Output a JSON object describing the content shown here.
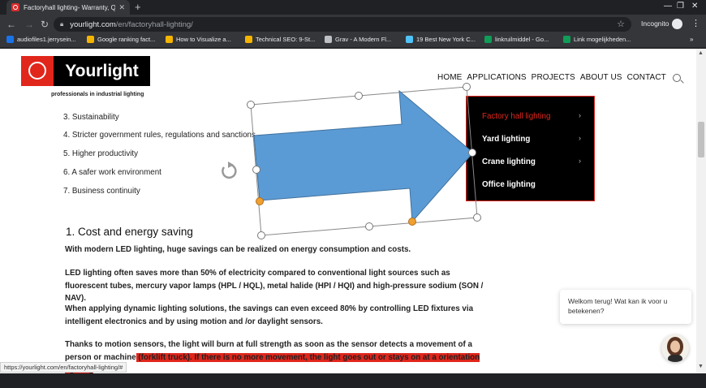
{
  "browser": {
    "tab_title": "Factoryhall lighting- Warranty, Q",
    "url_host": "yourlight.com",
    "url_path": "/en/factoryhall-lighting/",
    "incognito_label": "Incognito",
    "status_url": "https://yourlight.com/en/factoryhall-lighting/#"
  },
  "bookmarks": [
    {
      "label": "audiofiles1.jerrysein...",
      "icon": "audio-icon",
      "color": "#1a73e8"
    },
    {
      "label": "Google ranking fact...",
      "icon": "grid-icon",
      "color": "#f4b400"
    },
    {
      "label": "How to Visualize a...",
      "icon": "grid-icon",
      "color": "#f4b400"
    },
    {
      "label": "Technical SEO: 9-St...",
      "icon": "grid-icon",
      "color": "#f4b400"
    },
    {
      "label": "Grav - A Modern Fl...",
      "icon": "grav-icon",
      "color": "#bdc1c6"
    },
    {
      "label": "19 Best New York C...",
      "icon": "link-icon",
      "color": "#4fc3f7"
    },
    {
      "label": "linkruilmiddel - Go...",
      "icon": "sheet-icon",
      "color": "#0f9d58"
    },
    {
      "label": "Link mogelijkheden...",
      "icon": "sheet-icon",
      "color": "#0f9d58"
    }
  ],
  "site": {
    "logo_text": "Yourlight",
    "tagline": "professionals in industrial lighting",
    "nav": [
      "HOME",
      "APPLICATIONS",
      "PROJECTS",
      "ABOUT US",
      "CONTACT"
    ]
  },
  "list": [
    "3. Sustainability",
    "4. Stricter government rules, regulations and sanctions",
    "5. Higher productivity",
    "6. A safer work environment",
    "7. Business continuity"
  ],
  "dropdown": [
    {
      "label": "Factory hall lighting",
      "active": true,
      "chevron": true
    },
    {
      "label": "Yard lighting",
      "active": false,
      "chevron": true
    },
    {
      "label": "Crane lighting",
      "active": false,
      "chevron": true
    },
    {
      "label": "Office lighting",
      "active": false,
      "chevron": false
    }
  ],
  "section": {
    "heading": "1. Cost and energy saving",
    "p1": "With modern LED lighting, huge savings can be realized on energy consumption and costs.",
    "p2": "LED lighting often saves more than 50% of electricity compared to conventional light sources such as fluorescent tubes, mercury vapor lamps (HPL / HQL), metal halide (HPI / HQI) and high-pressure sodium (SON / NAV).",
    "p3": "When applying dynamic lighting solutions, the savings can even exceed 80% by controlling LED fixtures via intelligent electronics and by using motion and /or daylight sensors.",
    "p4_start": "Thanks to motion sensors, the light will burn at full strength as soon as the sensor detects a movement of a person or machine",
    "p4_highlight": " (forklift truck). If there is no more movement, the light goes out or stays on at a orientation lighting"
  },
  "chat": {
    "message": "Welkom terug! Wat kan ik voor u betekenen?"
  },
  "colors": {
    "brand_red": "#e1261c",
    "arrow_fill": "#5b9bd5",
    "handle_orange": "#f0a030"
  }
}
